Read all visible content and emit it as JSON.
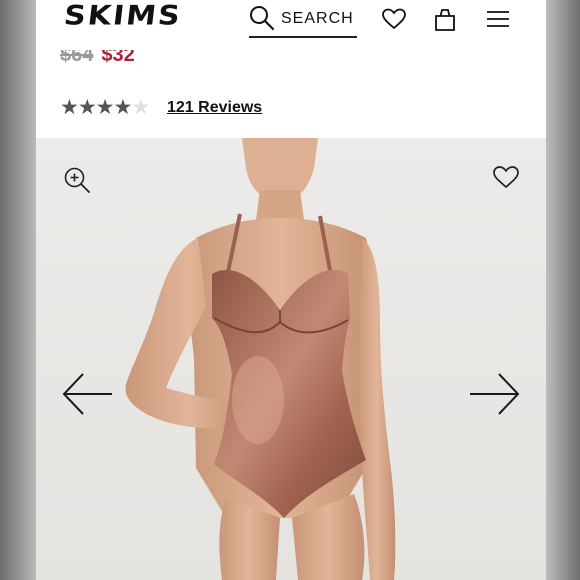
{
  "header": {
    "logo": "SKIMS",
    "search_label": "SEARCH",
    "icons": [
      "search-icon",
      "heart-icon",
      "bag-icon",
      "menu-icon"
    ]
  },
  "product": {
    "price_original": "$64",
    "price_sale": "$32",
    "rating": 4,
    "rating_max": 5,
    "reviews_label": "121 Reviews"
  },
  "gallery": {
    "icons": [
      "zoom-in-icon",
      "heart-icon",
      "arrow-left-icon",
      "arrow-right-icon"
    ]
  },
  "colors": {
    "sale_price": "#a3263a",
    "star": "#58544e",
    "garment": "#a56a56"
  }
}
